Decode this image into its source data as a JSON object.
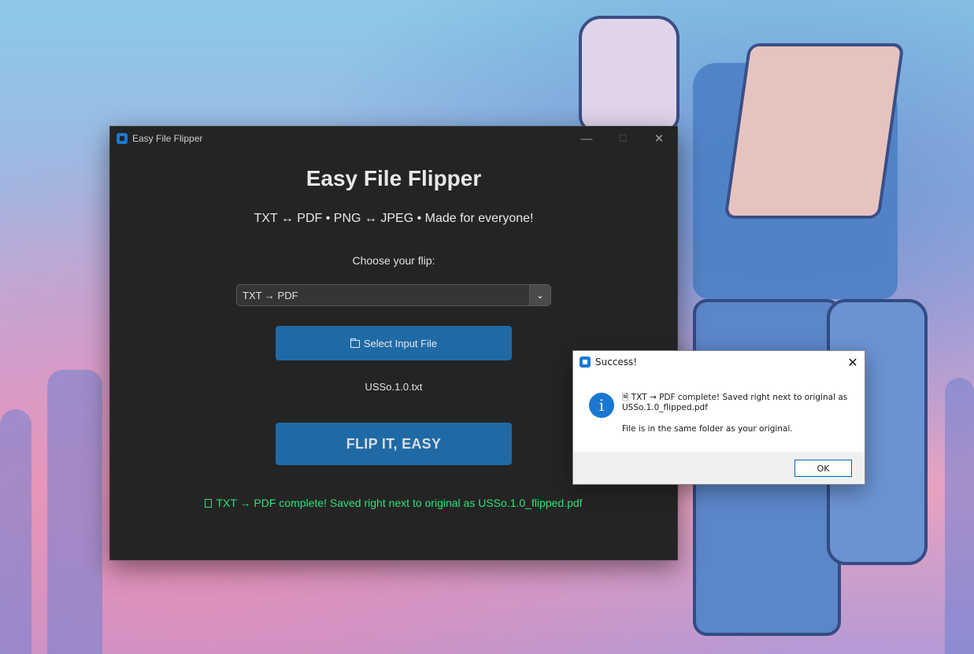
{
  "window": {
    "title": "Easy File Flipper",
    "minimize": "—",
    "maximize": "☐",
    "close": "✕"
  },
  "main": {
    "heading": "Easy File Flipper",
    "subtitle": "TXT ↔ PDF • PNG ↔ JPEG • Made for everyone!",
    "choose_label": "Choose your flip:",
    "flip_option": "TXT → PDF",
    "select_button": "Select Input File",
    "selected_file": "USSo.1.0.txt",
    "flip_button": "FLIP IT, EASY",
    "status": "TXT → PDF complete! Saved right next to original as USSo.1.0_flipped.pdf"
  },
  "dialog": {
    "title": "Success!",
    "close": "✕",
    "message_line1": "TXT → PDF complete! Saved right next to original as USSo.1.0_flipped.pdf",
    "message_line2": "File is in the same folder as your original.",
    "ok": "OK"
  },
  "colors": {
    "accent": "#1f6aa5",
    "status_green": "#2ee07a",
    "window_bg": "#242424"
  }
}
